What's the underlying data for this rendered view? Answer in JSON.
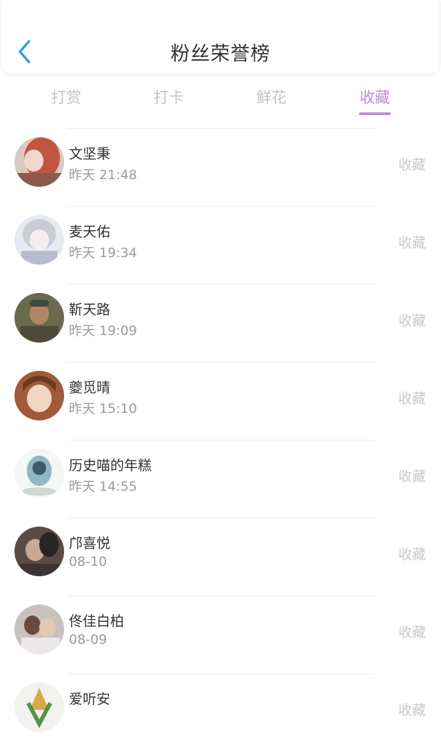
{
  "header": {
    "title": "粉丝荣誉榜"
  },
  "tabs": [
    {
      "label": "打赏",
      "active": false
    },
    {
      "label": "打卡",
      "active": false
    },
    {
      "label": "鲜花",
      "active": false
    },
    {
      "label": "收藏",
      "active": true
    }
  ],
  "colors": {
    "accent": "#b98fd6",
    "back": "#2f9ee6",
    "inactive": "#c4c4c4"
  },
  "fans": [
    {
      "name": "文坚秉",
      "time": "昨天 21:48",
      "action": "收藏"
    },
    {
      "name": "麦天佑",
      "time": "昨天 19:34",
      "action": "收藏"
    },
    {
      "name": "靳天路",
      "time": "昨天 19:09",
      "action": "收藏"
    },
    {
      "name": "夔觅晴",
      "time": "昨天 15:10",
      "action": "收藏"
    },
    {
      "name": "历史喵的年糕",
      "time": "昨天 14:55",
      "action": "收藏"
    },
    {
      "name": "邝喜悦",
      "time": "08-10",
      "action": "收藏"
    },
    {
      "name": "佟佳白柏",
      "time": "08-09",
      "action": "收藏"
    },
    {
      "name": "爱听安",
      "time": "",
      "action": "收藏"
    }
  ]
}
